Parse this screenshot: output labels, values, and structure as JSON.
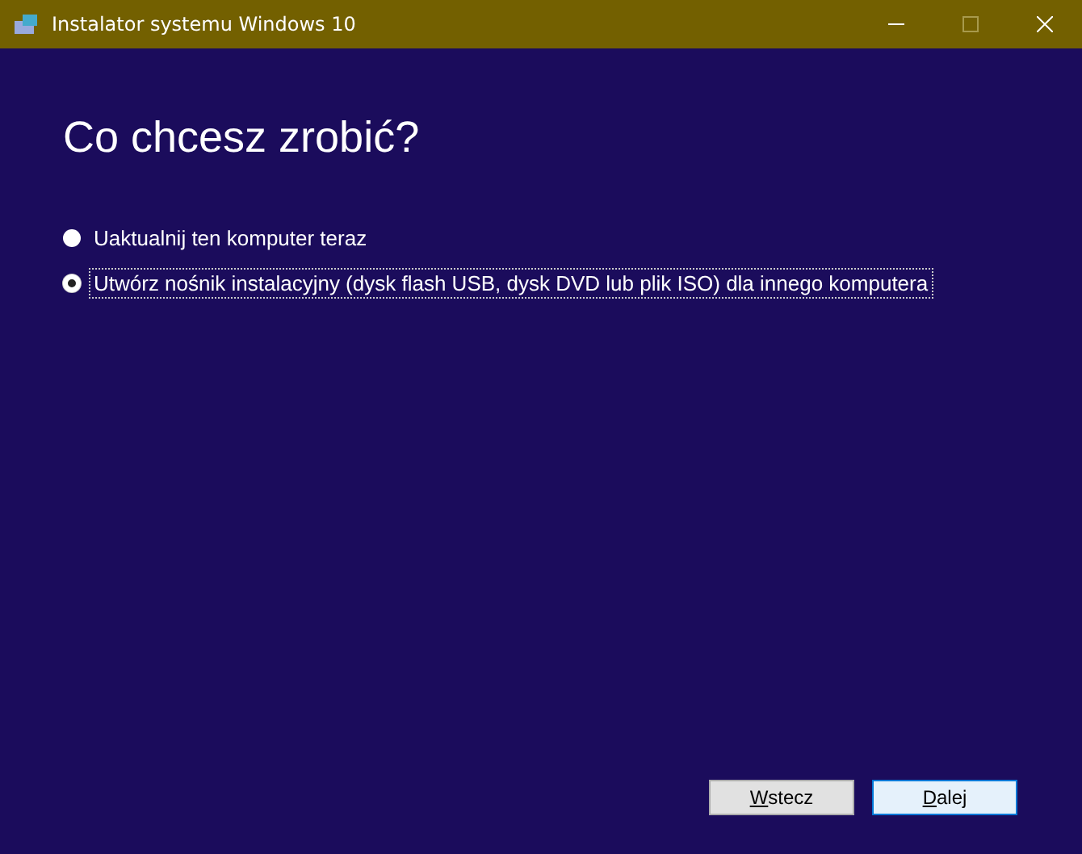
{
  "window": {
    "title": "Instalator systemu Windows 10"
  },
  "heading": "Co chcesz zrobić?",
  "options": [
    {
      "label": "Uaktualnij ten komputer teraz",
      "selected": false
    },
    {
      "label": "Utwórz nośnik instalacyjny (dysk flash USB, dysk DVD lub plik ISO) dla innego komputera",
      "selected": true
    }
  ],
  "buttons": [
    {
      "label": "Wstecz",
      "default": false
    },
    {
      "label": "Dalej",
      "default": true
    }
  ]
}
